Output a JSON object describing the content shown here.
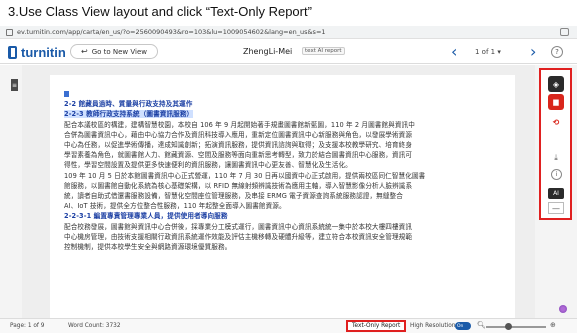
{
  "caption": "3.Use Class View layout and click “Text-Only Report”",
  "browser": {
    "url": "ev.turnitin.com/app/carta/en_us/?o=2560090493&ro=103&lu=1009054602&lang=en_us&s=1"
  },
  "header": {
    "logo_text": "turnitin",
    "new_view_label": "Go to New View",
    "doc_name": "ZhengLi-Mei",
    "report_tag": "text AI report",
    "page_selector": "1 of 1 ▾",
    "help_label": "?"
  },
  "document": {
    "lines": [
      {
        "text": "2-2  館藏員過時、質量與行政支持及其運作",
        "style": "hlline"
      },
      {
        "text": "2-2-3  教師行政支持系統（圖書資訊服務）",
        "style": "hl"
      },
      {
        "text": "配合本議校區的構建，建構智慧校園，本校自 106 年 9 月起開始著手規畫圖書館新藍圖，110 年 2 月圖書館與資訊中",
        "style": ""
      },
      {
        "text": "合併為圖書資訊中心，藉由中心協力合作及資訊科技導入應用，重新定位圖書資訊中心新服務與角色，以發展學術資源",
        "style": ""
      },
      {
        "text": "中心為任務，以促進學術傳播，達成知識創新；拓演資訊服務，提供資訊諮詢與取得；及支援本校教學研究、培育終身",
        "style": ""
      },
      {
        "text": "學習素養為角色，就圖書館人力、館藏資源、空間及服務等面向重新思考轉型，致力於結合圖書資訊中心服務，資訊可",
        "style": ""
      },
      {
        "text": "得性，學習空間設置及提供更多快速便利的資訊服務，讓圖書資訊中心更友善、智慧化及生活化。",
        "style": ""
      },
      {
        "text": "109 年 10 月 5 日於本館圖書資訊中心正式營運，110 年 7 月 30 日再以國資中心正式啟用，提供兩校區同仁智慧化圖書",
        "style": ""
      },
      {
        "text": "館服務，以圖書館自動化系統為核心基礎架構，以 RFID 無線射頻辨識技術為應用主軸，導入智慧影像分析人臉辨識系",
        "style": ""
      },
      {
        "text": "統，讀者自助式借還書服務設備，智慧化空間座位管理服務，及串接 ERMG 電子資源查詢系統服務認證，無縫整合",
        "style": ""
      },
      {
        "text": "AI、IoT 技術，提供全方位整合性服務，110 年起整全面導入圖書館資源。",
        "style": ""
      },
      {
        "text": "2-2-3-1 編置專責管理專業人員，提供使用者導向服務",
        "style": "hlline"
      },
      {
        "text": "配合校務發展，圖書館與資訊中心合併後，採專業分工模式運行，圖書資訊中心資訊系統統一集中於本校大樓四樓資訊",
        "style": ""
      },
      {
        "text": "中心機房管理，由技術支援相關行政資訊系統運作效能及評估主機移轉及硬體升級等，建立符合本校資訊安全管理規範",
        "style": ""
      },
      {
        "text": "控制機制，提供本校學生安全與網路資源環境優質服務。",
        "style": ""
      }
    ]
  },
  "sidebar": {
    "layers_icon": "layers-icon",
    "similarity_icon": "similarity-icon",
    "ai_icon": "ai-writing-icon",
    "download_icon": "download-icon",
    "info_icon": "info-icon",
    "ai_label": "AI",
    "collapse_label": "—"
  },
  "status": {
    "page_info": "Page: 1 of 9",
    "word_count": "Word Count: 3732",
    "text_only_report": "Text-Only Report",
    "high_resolution": "High Resolution",
    "toggle_state": "On"
  },
  "colors": {
    "brand": "#1a5aa8",
    "highlight": "#e02020",
    "similarity_red": "#d9261c"
  }
}
